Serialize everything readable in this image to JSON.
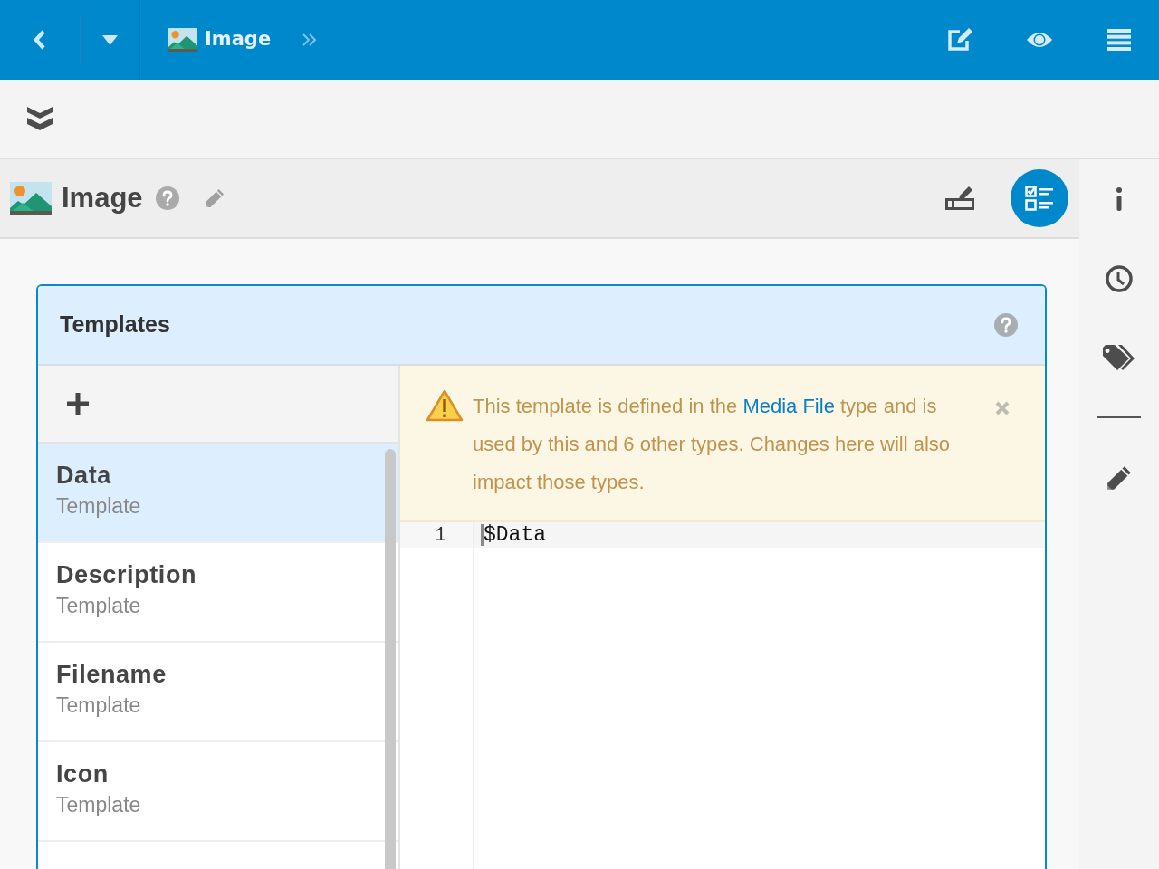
{
  "top_bar": {
    "breadcrumb": "Image"
  },
  "header": {
    "title": "Image",
    "tools": [
      {
        "kind": "field-editor",
        "selected": false
      },
      {
        "kind": "template-editor",
        "selected": true
      }
    ]
  },
  "panel": {
    "title": "Templates",
    "items": [
      {
        "title": "Data",
        "subtitle": "Template",
        "selected": true
      },
      {
        "title": "Description",
        "subtitle": "Template",
        "selected": false
      },
      {
        "title": "Filename",
        "subtitle": "Template",
        "selected": false
      },
      {
        "title": "Icon",
        "subtitle": "Template",
        "selected": false
      }
    ]
  },
  "notice": {
    "text_before": "This template is defined in the ",
    "link": "Media File",
    "text_after": " type and is used by this and 6 other types. Changes here will also impact those types."
  },
  "editor": {
    "lines": [
      {
        "number": "1",
        "code": "$Data"
      }
    ]
  }
}
